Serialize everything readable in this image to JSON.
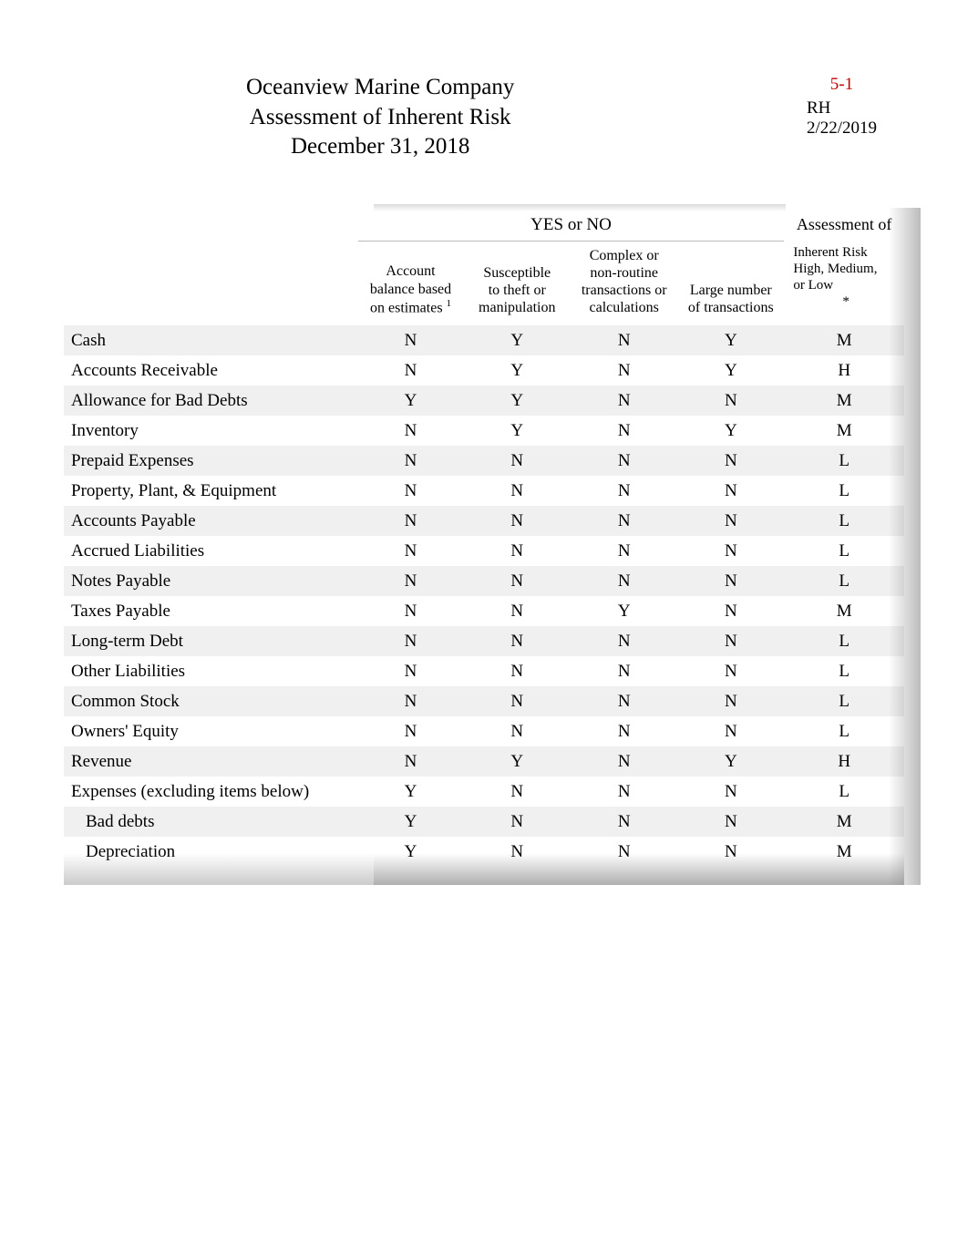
{
  "header": {
    "company": "Oceanview Marine Company",
    "subtitle": "Assessment of Inherent Risk",
    "date": "December 31, 2018"
  },
  "reference": {
    "number": "5-1",
    "initials": "RH",
    "ref_date": "2/22/2019"
  },
  "table": {
    "span_header": "YES or NO",
    "assessment_header": "Assessment of",
    "columns": {
      "c1_line1": "Account",
      "c1_line2": "balance based",
      "c1_line3": "on estimates",
      "c1_footnote": "1",
      "c2_line1": "Susceptible",
      "c2_line2": "to theft or",
      "c2_line3": "manipulation",
      "c3_line1": "Complex or",
      "c3_line2": "non-routine",
      "c3_line3": "transactions or",
      "c3_line4": "calculations",
      "c4_line1": "Large number",
      "c4_line2": "of transactions",
      "assess_line1": "Inherent Risk",
      "assess_line2": "High, Medium,",
      "assess_line3": "or Low",
      "assess_asterisk": "*"
    },
    "rows": [
      {
        "label": "Cash",
        "indent": false,
        "c1": "N",
        "c2": "Y",
        "c3": "N",
        "c4": "Y",
        "assess": "M"
      },
      {
        "label": "Accounts Receivable",
        "indent": false,
        "c1": "N",
        "c2": "Y",
        "c3": "N",
        "c4": "Y",
        "assess": "H"
      },
      {
        "label": "Allowance for Bad Debts",
        "indent": false,
        "c1": "Y",
        "c2": "Y",
        "c3": "N",
        "c4": "N",
        "assess": "M"
      },
      {
        "label": "Inventory",
        "indent": false,
        "c1": "N",
        "c2": "Y",
        "c3": "N",
        "c4": "Y",
        "assess": "M"
      },
      {
        "label": "Prepaid Expenses",
        "indent": false,
        "c1": "N",
        "c2": "N",
        "c3": "N",
        "c4": "N",
        "assess": "L"
      },
      {
        "label": "Property, Plant, & Equipment",
        "indent": false,
        "c1": "N",
        "c2": "N",
        "c3": "N",
        "c4": "N",
        "assess": "L"
      },
      {
        "label": "Accounts Payable",
        "indent": false,
        "c1": "N",
        "c2": "N",
        "c3": "N",
        "c4": "N",
        "assess": "L"
      },
      {
        "label": "Accrued Liabilities",
        "indent": false,
        "c1": "N",
        "c2": "N",
        "c3": "N",
        "c4": "N",
        "assess": "L"
      },
      {
        "label": "Notes Payable",
        "indent": false,
        "c1": "N",
        "c2": "N",
        "c3": "N",
        "c4": "N",
        "assess": "L"
      },
      {
        "label": "Taxes Payable",
        "indent": false,
        "c1": "N",
        "c2": "N",
        "c3": "Y",
        "c4": "N",
        "assess": "M"
      },
      {
        "label": "Long-term Debt",
        "indent": false,
        "c1": "N",
        "c2": "N",
        "c3": "N",
        "c4": "N",
        "assess": "L"
      },
      {
        "label": "Other Liabilities",
        "indent": false,
        "c1": "N",
        "c2": "N",
        "c3": "N",
        "c4": "N",
        "assess": "L"
      },
      {
        "label": "Common Stock",
        "indent": false,
        "c1": "N",
        "c2": "N",
        "c3": "N",
        "c4": "N",
        "assess": "L"
      },
      {
        "label": "Owners' Equity",
        "indent": false,
        "c1": "N",
        "c2": "N",
        "c3": "N",
        "c4": "N",
        "assess": "L"
      },
      {
        "label": "Revenue",
        "indent": false,
        "c1": "N",
        "c2": "Y",
        "c3": "N",
        "c4": "Y",
        "assess": "H"
      },
      {
        "label": "Expenses (excluding items below)",
        "indent": false,
        "c1": "Y",
        "c2": "N",
        "c3": "N",
        "c4": "N",
        "assess": "L"
      },
      {
        "label": "Bad debts",
        "indent": true,
        "c1": "Y",
        "c2": "N",
        "c3": "N",
        "c4": "N",
        "assess": "M"
      },
      {
        "label": "Depreciation",
        "indent": true,
        "c1": "Y",
        "c2": "N",
        "c3": "N",
        "c4": "N",
        "assess": "M"
      }
    ]
  }
}
